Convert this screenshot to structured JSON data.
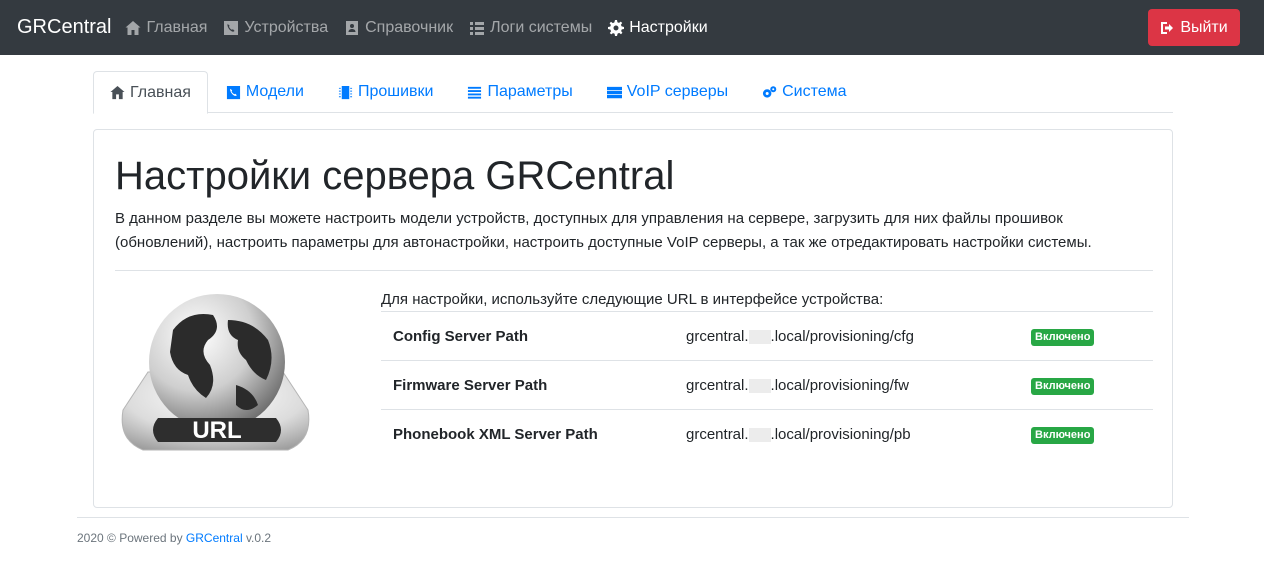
{
  "navbar": {
    "brand": "GRCentral",
    "items": [
      {
        "label": "Главная",
        "icon": "home-icon",
        "active": false
      },
      {
        "label": "Устройства",
        "icon": "phone-icon",
        "active": false
      },
      {
        "label": "Справочник",
        "icon": "address-book-icon",
        "active": false
      },
      {
        "label": "Логи системы",
        "icon": "list-icon",
        "active": false
      },
      {
        "label": "Настройки",
        "icon": "gear-icon",
        "active": true
      }
    ],
    "logout_label": "Выйти",
    "logout_color": "#dc3545"
  },
  "tabs": [
    {
      "label": "Главная",
      "icon": "home-icon",
      "active": true
    },
    {
      "label": "Модели",
      "icon": "phone-icon",
      "active": false
    },
    {
      "label": "Прошивки",
      "icon": "microchip-icon",
      "active": false
    },
    {
      "label": "Параметры",
      "icon": "bars-icon",
      "active": false
    },
    {
      "label": "VoIP серверы",
      "icon": "server-icon",
      "active": false
    },
    {
      "label": "Система",
      "icon": "cogs-icon",
      "active": false
    }
  ],
  "main": {
    "title": "Настройки сервера GRCentral",
    "lead": "В данном разделе вы можете настроить модели устройств, доступных для управления на сервере, загрузить для них файлы прошивок (обновлений), настроить параметры для автонастройки, настроить доступные VoIP серверы, а так же отредактировать настройки системы.",
    "image_label": "URL",
    "hint": "Для настройки, используйте следующие URL в интерфейсе устройства:",
    "urls": [
      {
        "name": "Config Server Path",
        "prefix": "grcentral.",
        "suffix": ".local/provisioning/cfg",
        "status": "Включено"
      },
      {
        "name": "Firmware Server Path",
        "prefix": "grcentral.",
        "suffix": ".local/provisioning/fw",
        "status": "Включено"
      },
      {
        "name": "Phonebook XML Server Path",
        "prefix": "grcentral.",
        "suffix": ".local/provisioning/pb",
        "status": "Включено"
      }
    ],
    "status_color": "#28a745"
  },
  "footer": {
    "text": "2020 © Powered by ",
    "link": "GRCentral",
    "version": " v.0.2"
  },
  "colors": {
    "navbar": "#343a40",
    "link": "#007bff"
  }
}
